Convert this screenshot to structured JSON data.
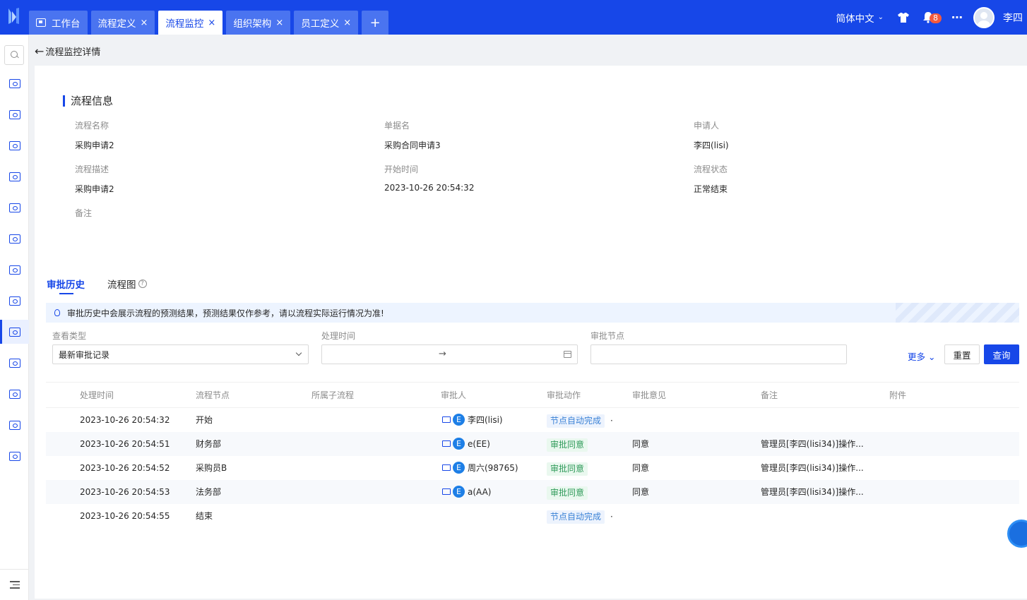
{
  "topbar": {
    "tabs": [
      {
        "label": "工作台",
        "active": false,
        "closable": false
      },
      {
        "label": "流程定义",
        "active": false,
        "closable": true
      },
      {
        "label": "流程监控",
        "active": true,
        "closable": true
      },
      {
        "label": "组织架构",
        "active": false,
        "closable": true
      },
      {
        "label": "员工定义",
        "active": false,
        "closable": true
      }
    ],
    "add_label": "+",
    "close_glyph": "×",
    "language": "简体中文",
    "notification_count": "8",
    "user_name": "李四"
  },
  "breadcrumb": {
    "back_label": "流程监控详情"
  },
  "process_info": {
    "title": "流程信息",
    "fields": {
      "name_label": "流程名称",
      "name_value": "采购申请2",
      "doc_label": "单据名",
      "doc_value": "采购合同申请3",
      "applicant_label": "申请人",
      "applicant_value": "李四(lisi)",
      "desc_label": "流程描述",
      "desc_value": "采购申请2",
      "start_label": "开始时间",
      "start_value": "2023-10-26 20:54:32",
      "status_label": "流程状态",
      "status_value": "正常结束",
      "remark_label": "备注"
    }
  },
  "panel_tabs": [
    {
      "label": "审批历史",
      "active": true
    },
    {
      "label": "流程图",
      "active": false
    }
  ],
  "alert": {
    "text": "审批历史中会展示流程的预测结果，预测结果仅作参考，请以流程实际运行情况为准!"
  },
  "filters": {
    "view_type_label": "查看类型",
    "view_type_value": "最新审批记录",
    "time_label": "处理时间",
    "time_separator": "→",
    "node_label": "审批节点",
    "more_label": "更多",
    "reset_label": "重置",
    "query_label": "查询"
  },
  "table": {
    "headers": [
      "处理时间",
      "流程节点",
      "所属子流程",
      "审批人",
      "审批动作",
      "审批意见",
      "备注",
      "附件"
    ],
    "rows": [
      {
        "time": "2023-10-26 20:54:32",
        "node": "开始",
        "subflow": "",
        "approver": "李四(lisi)",
        "approver_badge": "E",
        "action": "节点自动完成",
        "action_type": "auto",
        "opinion": "",
        "remark": "",
        "attachment": ""
      },
      {
        "time": "2023-10-26 20:54:51",
        "node": "财务部",
        "subflow": "",
        "approver": "e(EE)",
        "approver_badge": "E",
        "action": "审批同意",
        "action_type": "ok",
        "opinion": "同意",
        "remark": "管理员[李四(lisi34)]操作...",
        "attachment": ""
      },
      {
        "time": "2023-10-26 20:54:52",
        "node": "采购员B",
        "subflow": "",
        "approver": "周六(98765)",
        "approver_badge": "E",
        "action": "审批同意",
        "action_type": "ok",
        "opinion": "同意",
        "remark": "管理员[李四(lisi34)]操作...",
        "attachment": ""
      },
      {
        "time": "2023-10-26 20:54:53",
        "node": "法务部",
        "subflow": "",
        "approver": "a(AA)",
        "approver_badge": "E",
        "action": "审批同意",
        "action_type": "ok",
        "opinion": "同意",
        "remark": "管理员[李四(lisi34)]操作...",
        "attachment": ""
      },
      {
        "time": "2023-10-26 20:54:55",
        "node": "结束",
        "subflow": "",
        "approver": "",
        "approver_badge": "",
        "action": "节点自动完成",
        "action_type": "auto",
        "opinion": "",
        "remark": "",
        "attachment": ""
      }
    ]
  },
  "colors": {
    "brand": "#1747e8",
    "approve_green": "#2e9a59",
    "auto_blue": "#3b82d6",
    "badge_red": "#f5593c"
  },
  "icons": {
    "sidebar": [
      "search-icon",
      "monitor-icon",
      "monitor-icon",
      "org-tree-icon",
      "gear-icon",
      "code-window-icon",
      "code-window-icon",
      "mail-settings-icon",
      "flow-monitor-icon",
      "window-settings-icon",
      "list-settings-icon",
      "window-stats-icon",
      "export-icon",
      "sliders-icon"
    ],
    "bottom": "menu-fold-icon"
  }
}
